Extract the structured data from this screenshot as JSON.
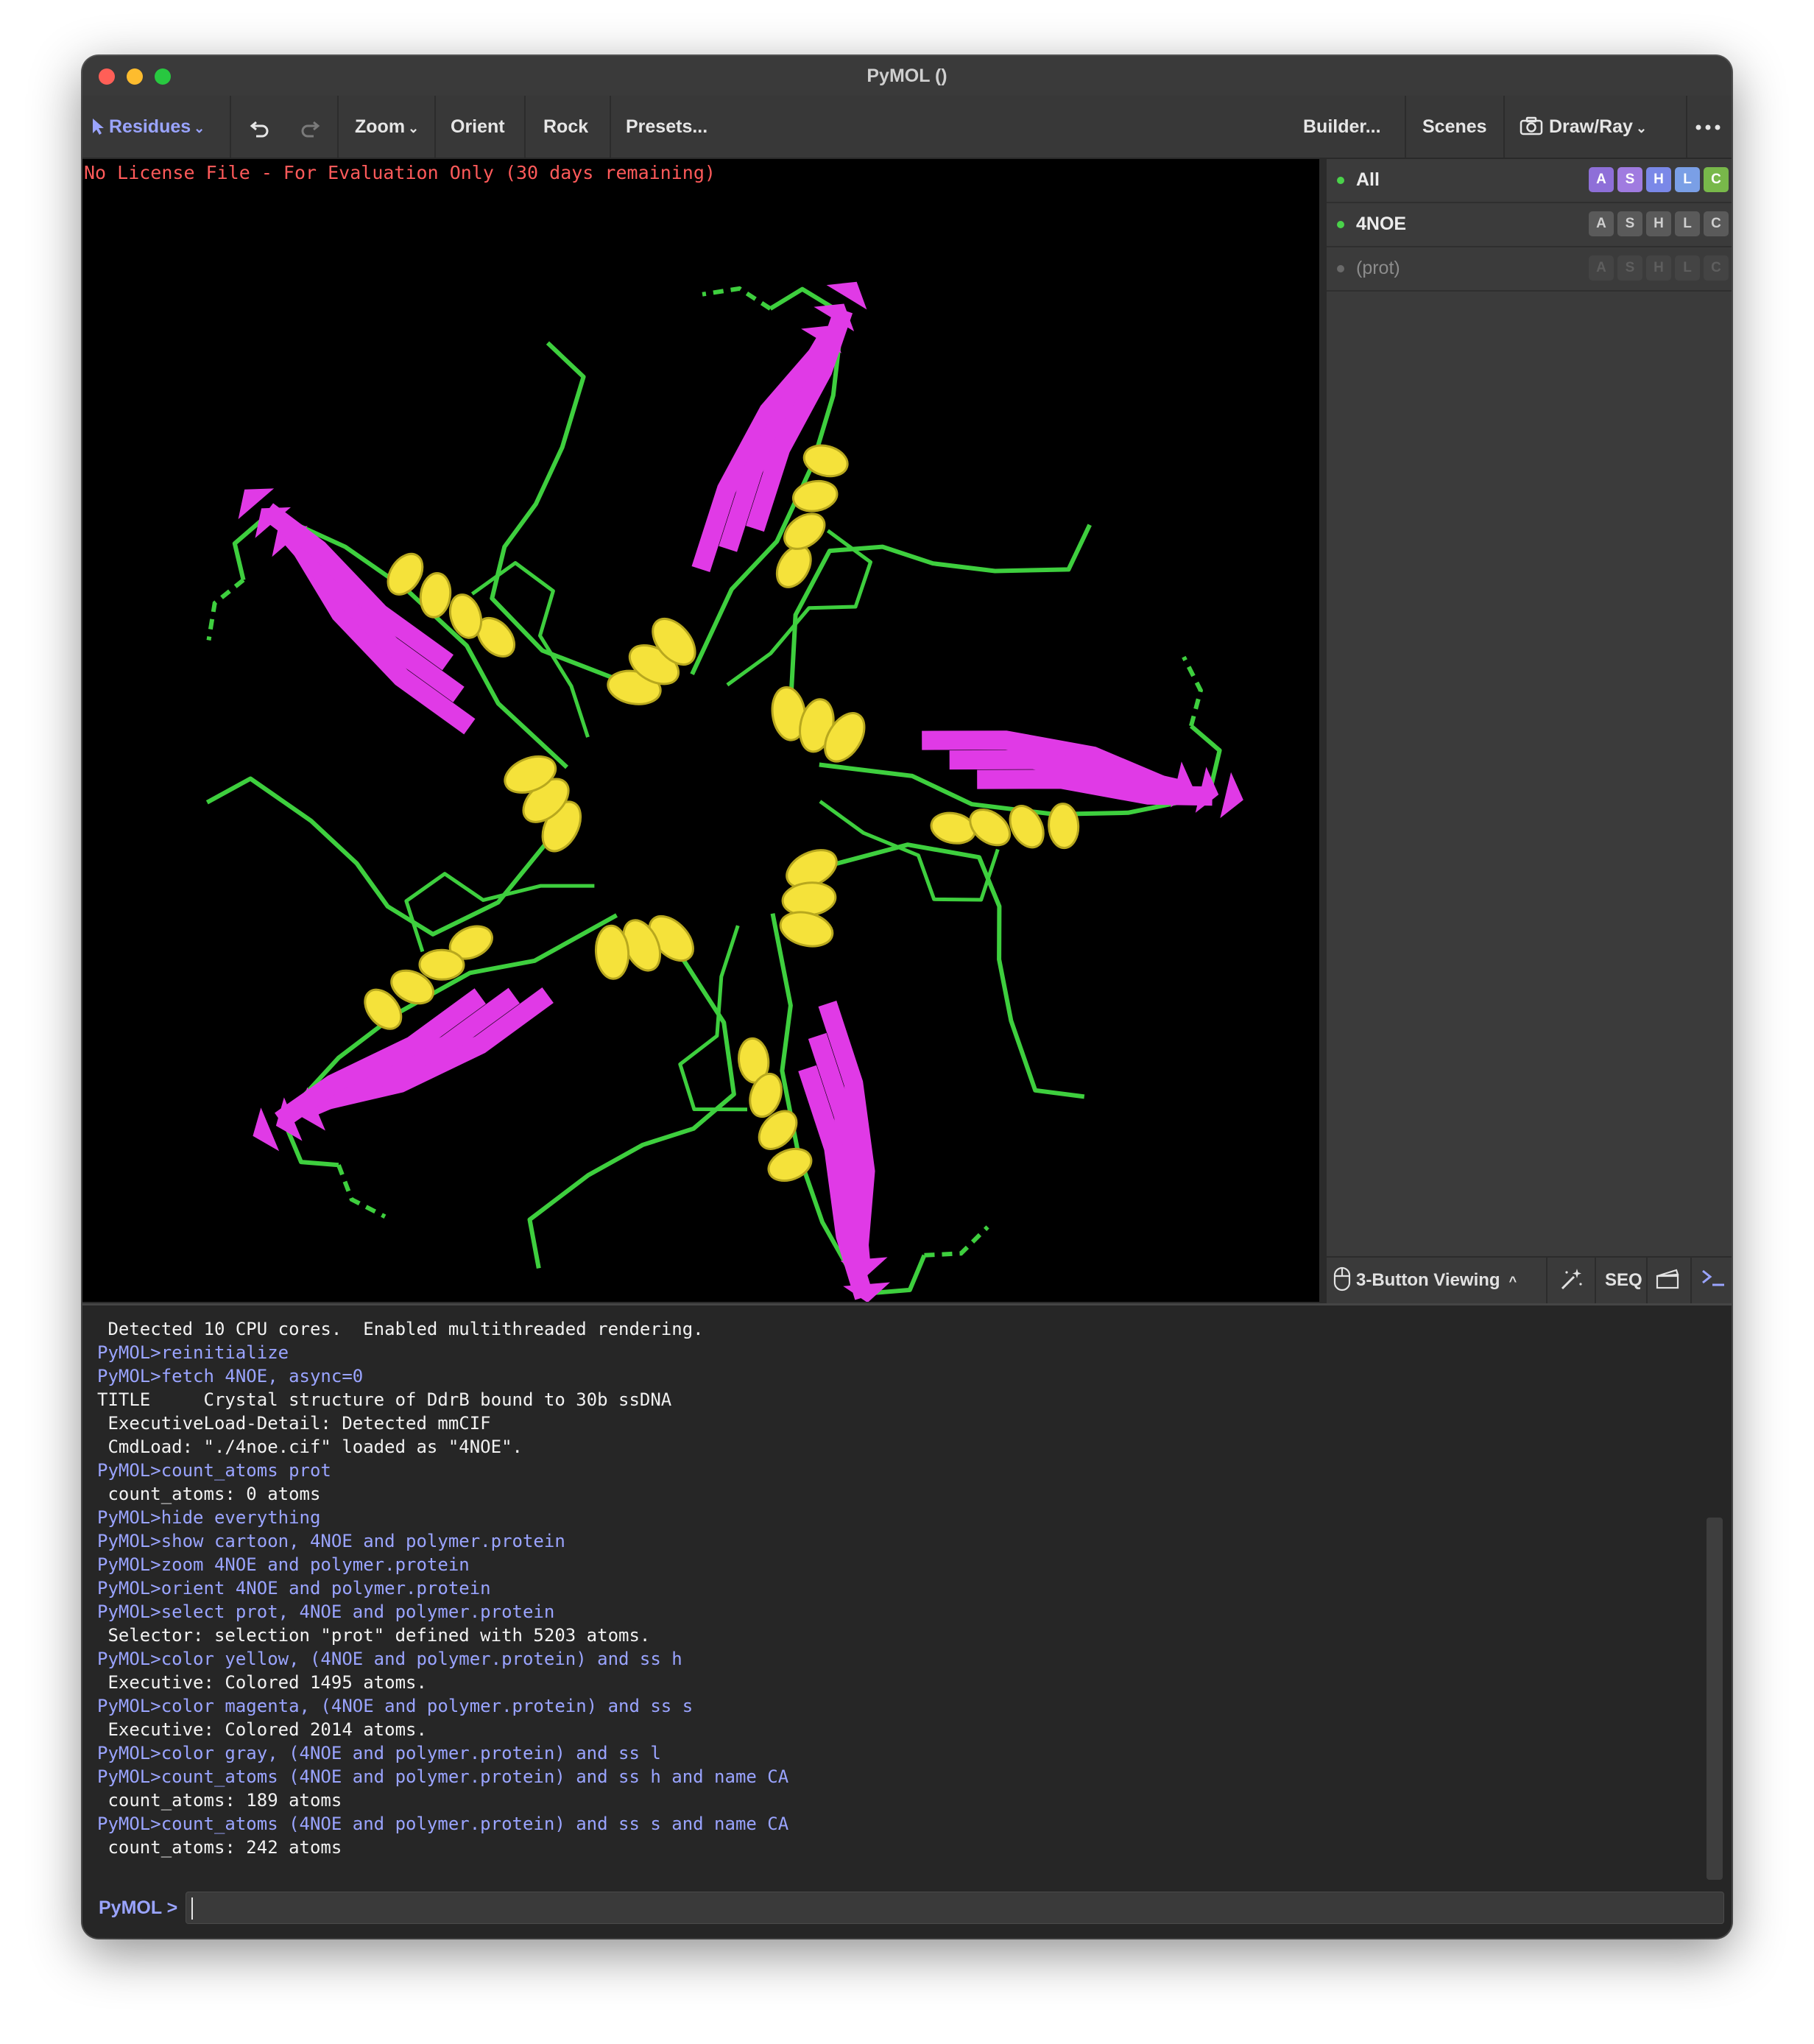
{
  "window": {
    "title": "PyMOL ()",
    "traffic_lights": {
      "close": "#ff5f57",
      "minimize": "#febc2e",
      "zoom": "#28c840"
    }
  },
  "toolbar": {
    "mode_label": "Residues",
    "mode_icon": "cursor-arrow-icon",
    "undo_icon": "undo-icon",
    "redo_icon": "redo-icon",
    "zoom_label": "Zoom",
    "orient_label": "Orient",
    "rock_label": "Rock",
    "presets_label": "Presets...",
    "builder_label": "Builder...",
    "scenes_label": "Scenes",
    "drawray_label": "Draw/Ray",
    "camera_icon": "camera-icon",
    "more_icon": "more-dots-icon",
    "accent": "#9aa4ff"
  },
  "viewer": {
    "license_notice": "No License File - For Evaluation Only (30 days remaining)",
    "background": "#000000",
    "colors": {
      "helix": "#f5e23a",
      "sheet": "#e03ae6",
      "loop": "#3ecf3e"
    }
  },
  "objects": [
    {
      "name": "All",
      "enabled": true,
      "buttons": [
        "A",
        "S",
        "H",
        "L",
        "C"
      ]
    },
    {
      "name": "4NOE",
      "enabled": true,
      "buttons": [
        "A",
        "S",
        "H",
        "L",
        "C"
      ]
    },
    {
      "name": "(prot)",
      "enabled": false,
      "buttons": [
        "A",
        "S",
        "H",
        "L",
        "C"
      ]
    }
  ],
  "button_colors": {
    "A": "#8e6fd8",
    "S": "#a07be0",
    "H": "#7a88e8",
    "L": "#7a9fe6",
    "C": "#78b84a"
  },
  "bottom_bar": {
    "mouse_mode": "3-Button Viewing",
    "wizard_icon": "magic-wand-icon",
    "seq_label": "SEQ",
    "movie_icon": "clapperboard-icon",
    "console_icon": "terminal-icon"
  },
  "console": {
    "lines": [
      {
        "type": "out",
        "text": " Detected 10 CPU cores.  Enabled multithreaded rendering."
      },
      {
        "type": "cmd",
        "text": "PyMOL>reinitialize"
      },
      {
        "type": "cmd",
        "text": "PyMOL>fetch 4NOE, async=0"
      },
      {
        "type": "out",
        "text": "TITLE     Crystal structure of DdrB bound to 30b ssDNA"
      },
      {
        "type": "out",
        "text": " ExecutiveLoad-Detail: Detected mmCIF"
      },
      {
        "type": "out",
        "text": " CmdLoad: \"./4noe.cif\" loaded as \"4NOE\"."
      },
      {
        "type": "cmd",
        "text": "PyMOL>count_atoms prot"
      },
      {
        "type": "out",
        "text": " count_atoms: 0 atoms"
      },
      {
        "type": "cmd",
        "text": "PyMOL>hide everything"
      },
      {
        "type": "cmd",
        "text": "PyMOL>show cartoon, 4NOE and polymer.protein"
      },
      {
        "type": "cmd",
        "text": "PyMOL>zoom 4NOE and polymer.protein"
      },
      {
        "type": "cmd",
        "text": "PyMOL>orient 4NOE and polymer.protein"
      },
      {
        "type": "cmd",
        "text": "PyMOL>select prot, 4NOE and polymer.protein"
      },
      {
        "type": "out",
        "text": " Selector: selection \"prot\" defined with 5203 atoms."
      },
      {
        "type": "cmd",
        "text": "PyMOL>color yellow, (4NOE and polymer.protein) and ss h"
      },
      {
        "type": "out",
        "text": " Executive: Colored 1495 atoms."
      },
      {
        "type": "cmd",
        "text": "PyMOL>color magenta, (4NOE and polymer.protein) and ss s"
      },
      {
        "type": "out",
        "text": " Executive: Colored 2014 atoms."
      },
      {
        "type": "cmd",
        "text": "PyMOL>color gray, (4NOE and polymer.protein) and ss l"
      },
      {
        "type": "cmd",
        "text": "PyMOL>count_atoms (4NOE and polymer.protein) and ss h and name CA"
      },
      {
        "type": "out",
        "text": " count_atoms: 189 atoms"
      },
      {
        "type": "cmd",
        "text": "PyMOL>count_atoms (4NOE and polymer.protein) and ss s and name CA"
      },
      {
        "type": "out",
        "text": " count_atoms: 242 atoms"
      }
    ],
    "prompt": "PyMOL >",
    "input_value": ""
  }
}
